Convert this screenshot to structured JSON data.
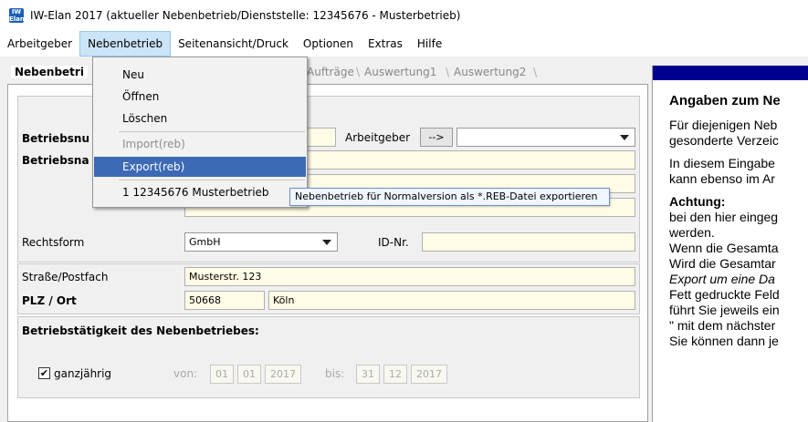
{
  "window": {
    "icon_label": "IW Elan",
    "title": "IW-Elan 2017  (aktueller Nebenbetrieb/Dienststelle: 12345676 - Musterbetrieb)"
  },
  "menubar": {
    "items": [
      "Arbeitgeber",
      "Nebenbetrieb",
      "Seitenansicht/Druck",
      "Optionen",
      "Extras",
      "Hilfe"
    ],
    "active_index": 1
  },
  "tabs": {
    "active": "Nebenbetri",
    "others": [
      "Aufträge",
      "Auswertung1",
      "Auswertung2"
    ]
  },
  "dropdown": {
    "items": [
      {
        "label": "Neu",
        "enabled": true
      },
      {
        "label": "Öffnen",
        "enabled": true
      },
      {
        "label": "Löschen",
        "enabled": true
      },
      {
        "label": "Import(reb)",
        "enabled": false
      },
      {
        "label": "Export(reb)",
        "enabled": true,
        "hover": true
      },
      {
        "label": "1 12345676 Musterbetrieb",
        "enabled": true
      }
    ],
    "tooltip": "Nebenbetrieb für Normalversion als *.REB-Datei exportieren"
  },
  "form": {
    "betriebsnr_label": "Betriebsnu",
    "betriebsname_label": "Betriebsna",
    "arbeitgeber_label": "Arbeitgeber",
    "arbeitgeber_button": "-->",
    "rechtsform_label": "Rechtsform",
    "rechtsform_value": "GmbH",
    "idnr_label": "ID-Nr.",
    "strasse_label": "Straße/Postfach",
    "strasse_value": "Musterstr. 123",
    "plz_ort_label": "PLZ  / Ort",
    "plz_value": "50668",
    "ort_value": "Köln",
    "betriebstaetigkeit_title": "Betriebstätigkeit des Nebenbetriebes:",
    "ganzjaehrig_label": "ganzjährig",
    "ganzjaehrig_checked": true,
    "von_label": "von:",
    "von_day": "01",
    "von_month": "01",
    "von_year": "2017",
    "bis_label": "bis:",
    "bis_day": "31",
    "bis_month": "12",
    "bis_year": "2017"
  },
  "help": {
    "title": "Angaben zum Ne",
    "p1_line1": "Für diejenigen Neb",
    "p1_line2": "gesonderte Verzeic",
    "p2_line1": "In diesem Eingabe",
    "p2_line2": "kann ebenso im Ar",
    "p3_heading": "Achtung:",
    "p3_line1": "bei den hier eingeg",
    "p3_line2": "werden.",
    "p3_line3": "Wenn die Gesamta",
    "p3_line4": "Wird die Gesamtar",
    "p3_line5": "Export um eine Da",
    "p3_line6": "Fett gedruckte Feld",
    "p3_line7": "führt Sie jeweils ein",
    "p3_line8": "\" mit dem nächster",
    "p3_line9": "Sie können dann je"
  },
  "colors": {
    "field_bg": "#fffbe6",
    "menu_hover": "#3c6ab5",
    "help_header": "#000090"
  }
}
